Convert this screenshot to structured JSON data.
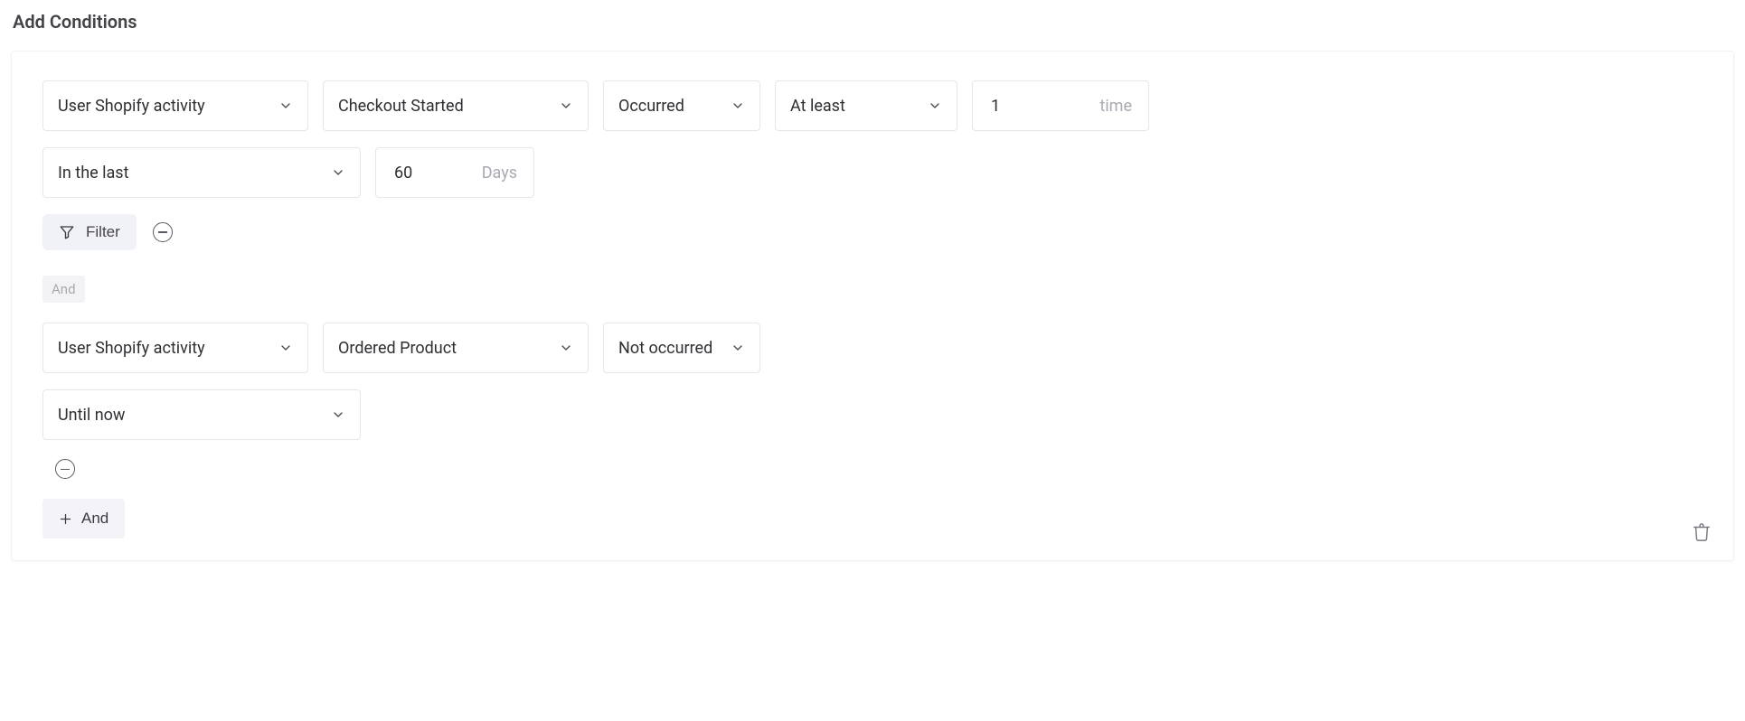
{
  "title": "Add Conditions",
  "condition1": {
    "activity_type": "User Shopify activity",
    "event": "Checkout Started",
    "occurrence": "Occurred",
    "comparator": "At least",
    "count": "1",
    "count_suffix": "time",
    "timeframe": "In the last",
    "days_value": "60",
    "days_suffix": "Days",
    "filter_label": "Filter"
  },
  "connector1": "And",
  "condition2": {
    "activity_type": "User Shopify activity",
    "event": "Ordered Product",
    "occurrence": "Not occurred",
    "timeframe": "Until now"
  },
  "add_and_label": "And"
}
